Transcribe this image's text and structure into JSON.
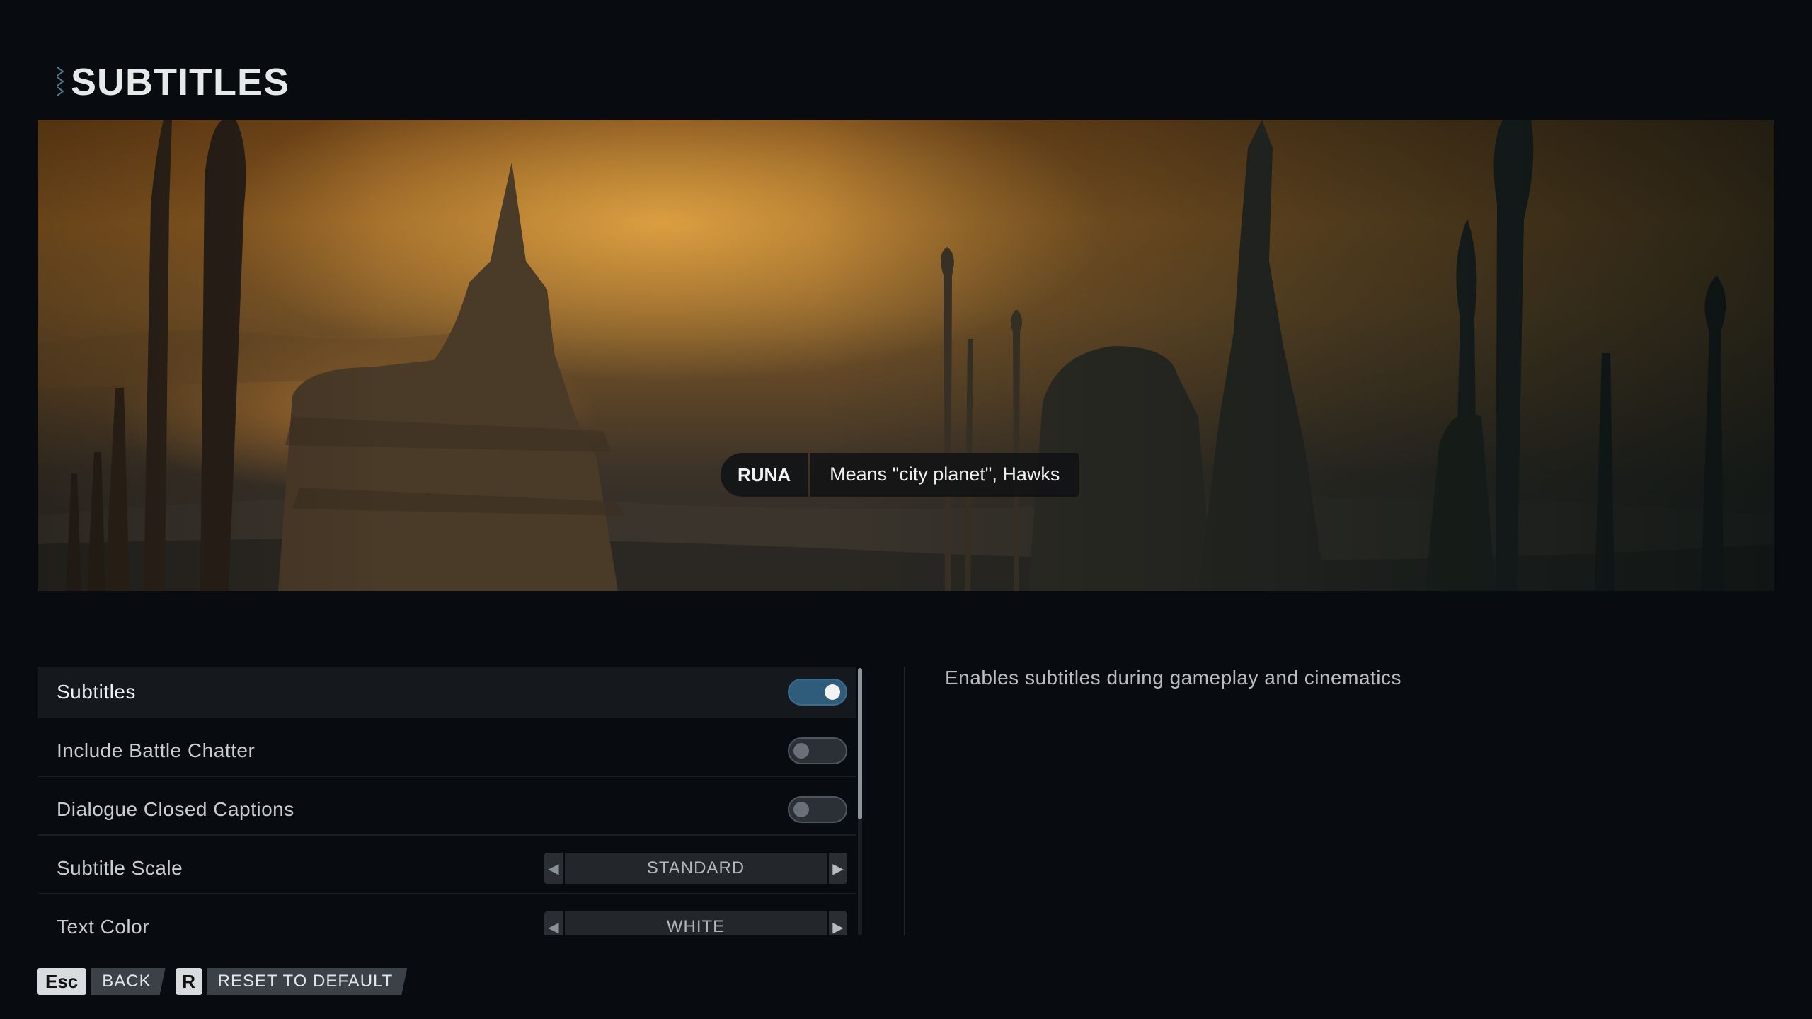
{
  "header": {
    "title": "SUBTITLES"
  },
  "preview": {
    "speaker": "RUNA",
    "caption": "Means \"city planet\", Hawks"
  },
  "settings": [
    {
      "label": "Subtitles",
      "type": "toggle",
      "value": true,
      "selected": true
    },
    {
      "label": "Include Battle Chatter",
      "type": "toggle",
      "value": false
    },
    {
      "label": "Dialogue Closed Captions",
      "type": "toggle",
      "value": false
    },
    {
      "label": "Subtitle Scale",
      "type": "selector",
      "value": "STANDARD"
    },
    {
      "label": "Text Color",
      "type": "selector",
      "value": "WHITE"
    }
  ],
  "description": "Enables subtitles during gameplay and cinematics",
  "footer": {
    "back": {
      "key": "Esc",
      "label": "BACK"
    },
    "reset": {
      "key": "R",
      "label": "RESET TO DEFAULT"
    }
  },
  "colors": {
    "accent": "#2f5c7a",
    "background": "#080b0f"
  }
}
